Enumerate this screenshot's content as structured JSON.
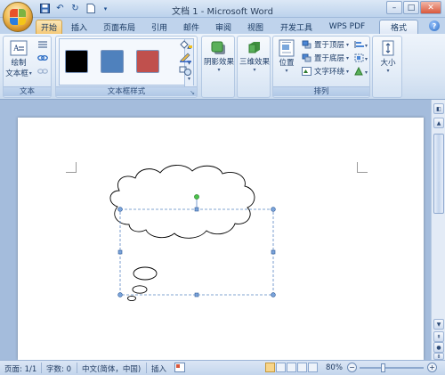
{
  "window": {
    "title": "文档 1 - Microsoft Word",
    "min_label": "–",
    "max_label": "□",
    "close_label": "✕"
  },
  "tabs": [
    {
      "label": "开始",
      "active": true
    },
    {
      "label": "插入"
    },
    {
      "label": "页面布局"
    },
    {
      "label": "引用"
    },
    {
      "label": "邮件"
    },
    {
      "label": "审阅"
    },
    {
      "label": "视图"
    },
    {
      "label": "开发工具"
    },
    {
      "label": "WPS PDF"
    },
    {
      "label": "格式",
      "context": true
    }
  ],
  "ribbon": {
    "text_group": {
      "label": "文本",
      "draw_textbox_line1": "绘制",
      "draw_textbox_line2": "文本框"
    },
    "textbox_styles": {
      "label": "文本框样式",
      "swatches": [
        "#000000",
        "#4f81bd",
        "#c0504d"
      ]
    },
    "shadow": {
      "label": "阴影效果"
    },
    "threed": {
      "label": "三维效果"
    },
    "arrange": {
      "label": "排列",
      "position": "位置",
      "bring_front": "置于顶层",
      "send_back": "置于底层",
      "text_wrap": "文字环绕"
    },
    "size": {
      "label": "大小"
    }
  },
  "status": {
    "page": "页面: 1/1",
    "words": "字数: 0",
    "language": "中文(简体，中国)",
    "mode": "插入",
    "zoom": "80%"
  }
}
